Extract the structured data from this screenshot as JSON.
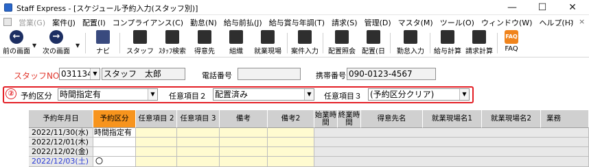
{
  "window": {
    "title": "Staff Express - [スケジュール予約入力(スタッフ別)]",
    "controls": {
      "minimize": "—",
      "maximize": "☐",
      "close": "✕"
    }
  },
  "menu": {
    "items": [
      {
        "label": "営業(G)",
        "enabled": false
      },
      {
        "label": "案件(J)",
        "enabled": true
      },
      {
        "label": "配置(I)",
        "enabled": true
      },
      {
        "label": "コンプライアンス(C)",
        "enabled": true
      },
      {
        "label": "勤怠(N)",
        "enabled": true
      },
      {
        "label": "給与前払(J)",
        "enabled": true
      },
      {
        "label": "給与賞与年調(T)",
        "enabled": true
      },
      {
        "label": "請求(S)",
        "enabled": true
      },
      {
        "label": "管理(D)",
        "enabled": true
      },
      {
        "label": "マスタ(M)",
        "enabled": true
      },
      {
        "label": "ツール(O)",
        "enabled": true
      },
      {
        "label": "ウィンドウ(W)",
        "enabled": true
      },
      {
        "label": "ヘルプ(H)",
        "enabled": true
      }
    ],
    "mdi": {
      "minimize": "_",
      "restore": "▫",
      "close": "×"
    }
  },
  "toolbar": {
    "buttons": [
      {
        "label": "前の画面",
        "icon": "arrow-left-icon"
      },
      {
        "label": "次の画面",
        "icon": "arrow-right-icon"
      },
      {
        "label": "ナビ",
        "icon": "navi-icon"
      },
      {
        "label": "スタッフ",
        "icon": "staff-icon"
      },
      {
        "label": "ｽﾀｯﾌ検索",
        "icon": "staff-search-icon"
      },
      {
        "label": "得意先",
        "icon": "customer-icon"
      },
      {
        "label": "組織",
        "icon": "organization-icon"
      },
      {
        "label": "就業現場",
        "icon": "workplace-icon"
      },
      {
        "label": "案件入力",
        "icon": "case-entry-icon"
      },
      {
        "label": "配置照会",
        "icon": "placement-inquiry-icon"
      },
      {
        "label": "配置(日",
        "icon": "placement-day-icon"
      },
      {
        "label": "勤怠入力",
        "icon": "attendance-entry-icon"
      },
      {
        "label": "給与計算",
        "icon": "payroll-calc-icon"
      },
      {
        "label": "請求計算",
        "icon": "billing-calc-icon"
      },
      {
        "label": "FAQ",
        "icon": "faq-icon"
      }
    ],
    "faq_icon_text": "FAQ"
  },
  "form": {
    "staff_no_label": "スタッフNO",
    "staff_no_value": "031134",
    "staff_name": "スタッフ　太郎",
    "phone_label": "電話番号",
    "phone_value": "",
    "mobile_label": "携帯番号",
    "mobile_value": "090-0123-4567",
    "badge": "②",
    "reservation_type_label": "予約区分",
    "reservation_type_value": "時間指定有",
    "optional_item2_label": "任意項目２",
    "optional_item2_value": "配置済み",
    "optional_item3_label": "任意項目３",
    "optional_item3_value": "(予約区分クリア)"
  },
  "grid": {
    "headers": [
      {
        "label": "予約年月日"
      },
      {
        "label": "予約区分"
      },
      {
        "label": "任意項目 2"
      },
      {
        "label": "任意項目 3"
      },
      {
        "label": "備考"
      },
      {
        "label": "備考2"
      },
      {
        "label": "始業時間"
      },
      {
        "label": "終業時間"
      },
      {
        "label": "得意先名"
      },
      {
        "label": "就業現場名1"
      },
      {
        "label": "就業現場名2"
      },
      {
        "label": "業務"
      }
    ],
    "rows": [
      {
        "date": "2022/11/30(水)",
        "type": "時間指定有",
        "saturday": false
      },
      {
        "date": "2022/12/01(木)",
        "type": "",
        "saturday": false
      },
      {
        "date": "2022/12/02(金)",
        "type": "",
        "saturday": false
      },
      {
        "date": "2022/12/03(土)",
        "type": "〇",
        "saturday": true
      }
    ]
  },
  "colors": {
    "highlight_frame": "#e31e24",
    "label_red": "#e0342a",
    "header_gray": "#d0d0d0",
    "header_orange": "#f7941d",
    "cell_yellow": "#fffbd0",
    "saturday_blue": "#2a3bd6"
  }
}
